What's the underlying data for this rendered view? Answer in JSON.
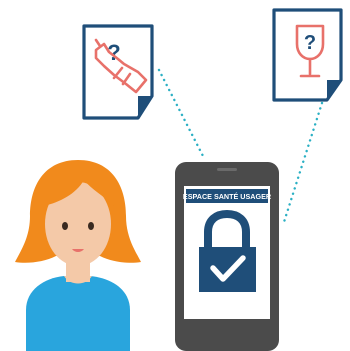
{
  "phone": {
    "header_label": "ESPACE SANTÉ USAGER"
  },
  "documents": {
    "left": {
      "mark": "?",
      "icon": "medical-device-icon"
    },
    "right": {
      "mark": "?",
      "icon": "wine-glass-icon"
    }
  },
  "icons": {
    "lock": "padlock-icon",
    "check": "checkmark-icon",
    "person": "woman-avatar-icon"
  },
  "colors": {
    "navy": "#1f4e79",
    "coral": "#e8716a",
    "teal_dots": "#2bb0c4",
    "phone_body": "#4b4b4b",
    "hair": "#f18a1c",
    "skin": "#f4c9a8",
    "shirt": "#29a5dd"
  }
}
